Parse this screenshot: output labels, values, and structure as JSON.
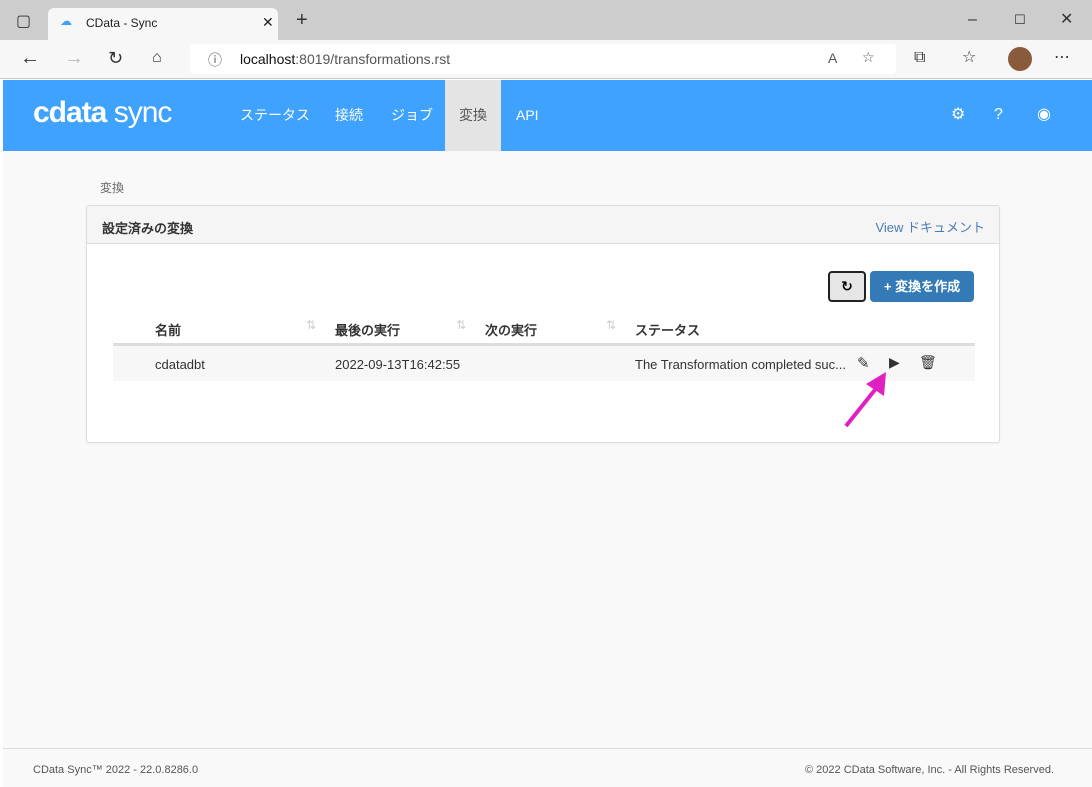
{
  "browser": {
    "tab_title": "CData - Sync",
    "url_host": "localhost",
    "url_path": ":8019/transformations.rst"
  },
  "app": {
    "logo_brand": "cdata",
    "logo_product": "sync",
    "nav": [
      "ステータス",
      "接続",
      "ジョブ",
      "変換",
      "API"
    ],
    "active_nav": "変換",
    "accent": "#3fa2fe"
  },
  "breadcrumb": "変換",
  "panel": {
    "title": "設定済みの変換",
    "doc_link": "View ドキュメント",
    "create_button": "+ 変換を作成",
    "columns": [
      "名前",
      "最後の実行",
      "次の実行",
      "ステータス"
    ],
    "rows": [
      {
        "name": "cdatadbt",
        "last_run": "2022-09-13T16:42:55",
        "next_run": "",
        "status": "The Transformation completed suc..."
      }
    ]
  },
  "footer": {
    "left": "CData Sync™ 2022 - 22.0.8286.0",
    "right": "© 2022 CData Software, Inc. - All Rights Reserved."
  }
}
